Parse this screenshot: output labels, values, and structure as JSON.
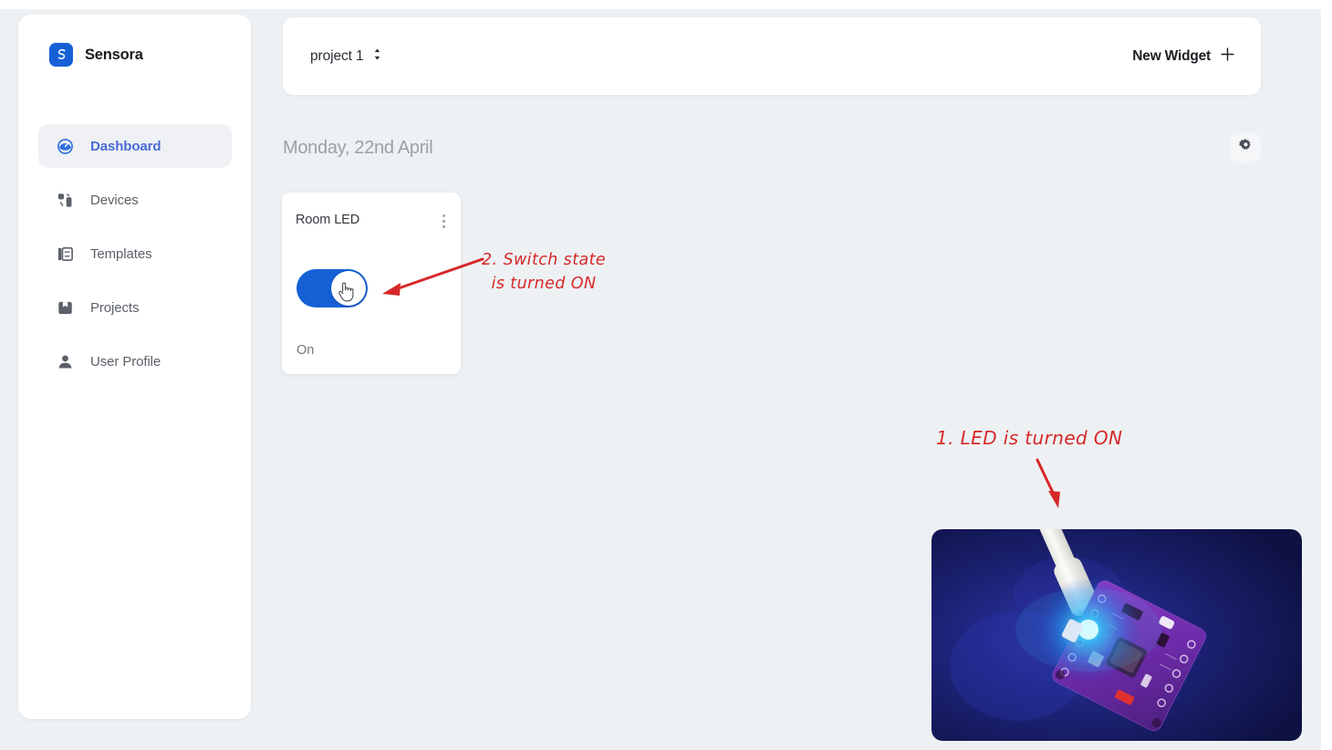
{
  "app": {
    "brand_name": "Sensora",
    "logo_icon": "sensora-s-logo",
    "accent_color": "#1660d6",
    "page_bg": "#eef1f3"
  },
  "sidebar": {
    "items": [
      {
        "label": "Dashboard",
        "icon": "gauge-icon",
        "active": true
      },
      {
        "label": "Devices",
        "icon": "devices-icon",
        "active": false
      },
      {
        "label": "Templates",
        "icon": "templates-icon",
        "active": false
      },
      {
        "label": "Projects",
        "icon": "book-icon",
        "active": false
      },
      {
        "label": "User Profile",
        "icon": "person-icon",
        "active": false
      }
    ]
  },
  "topbar": {
    "project_label": "project 1",
    "project_selector_icon": "chevron-up-down-icon",
    "new_widget_label": "New Widget",
    "new_widget_icon": "plus-icon"
  },
  "content": {
    "date_text": "Monday, 22nd April",
    "settings_icon": "gear-icon"
  },
  "widget": {
    "title": "Room LED",
    "menu_icon": "kebab-menu-icon",
    "toggle_state": "on",
    "toggle_color": "#1660d6",
    "status_label": "On",
    "cursor_icon": "hand-pointer-cursor"
  },
  "annotations": {
    "color": "#d62828",
    "switch_note": "2. Switch state\nis turned ON",
    "led_note": "1. LED is turned ON"
  },
  "photo": {
    "description": "microcontroller-board-with-blue-led-on",
    "background_color": "#1a1e5c",
    "led_glow_color": "#35e6f0",
    "board_color": "#7b2fbe",
    "cable_color": "#f2f2f0"
  }
}
